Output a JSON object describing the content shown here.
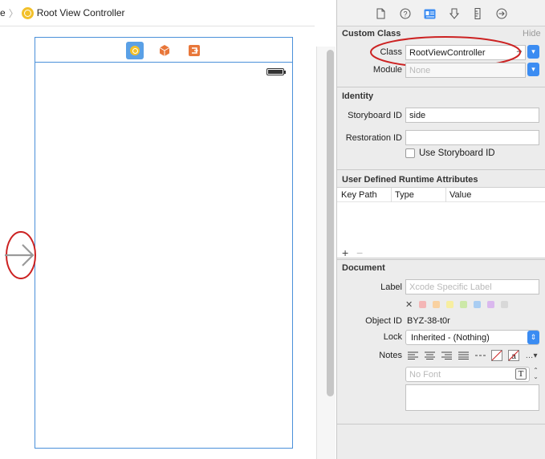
{
  "breadcrumb": {
    "fragment": "e",
    "title": "Root View Controller"
  },
  "scene": {
    "dock_icons": [
      "view-controller-icon",
      "first-responder-icon",
      "exit-icon"
    ],
    "dock_colors": [
      "#f2c02a",
      "#e8773a",
      "#e8773a"
    ]
  },
  "inspector": {
    "toolbar_icons": [
      "file-inspector-icon",
      "quick-help-icon",
      "identity-inspector-icon",
      "attributes-inspector-icon",
      "size-inspector-icon",
      "connections-inspector-icon"
    ],
    "custom_class": {
      "heading": "Custom Class",
      "hide": "Hide",
      "class_label": "Class",
      "class_value": "RootViewController",
      "module_label": "Module",
      "module_placeholder": "None"
    },
    "identity": {
      "heading": "Identity",
      "storyboard_id_label": "Storyboard ID",
      "storyboard_id_value": "side",
      "restoration_id_label": "Restoration ID",
      "restoration_id_value": "",
      "use_storyboard_id": "Use Storyboard ID"
    },
    "runtime_attributes": {
      "heading": "User Defined Runtime Attributes",
      "columns": [
        "Key Path",
        "Type",
        "Value"
      ],
      "add": "+",
      "remove": "−"
    },
    "document": {
      "heading": "Document",
      "label_label": "Label",
      "label_placeholder": "Xcode Specific Label",
      "label_swatches": [
        "#f4b6b6",
        "#f9d1a0",
        "#f7eea0",
        "#cce8a8",
        "#a9cdf2",
        "#dab8ee",
        "#d8d8d8"
      ],
      "clear_color": "✕",
      "object_id_label": "Object ID",
      "object_id_value": "BYZ-38-t0r",
      "lock_label": "Lock",
      "lock_value": "Inherited - (Nothing)",
      "notes_label": "Notes",
      "font_placeholder": "No Font"
    }
  },
  "annotations": {
    "highlight_color": "#cc2222"
  }
}
